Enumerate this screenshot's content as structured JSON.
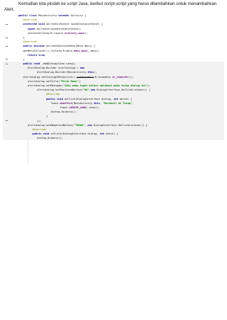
{
  "intro": {
    "text": "Kemudian kita pindah ke script Java, berikut script-script yang harus ditambahkan untuk menambahkan Alert."
  },
  "code": {
    "lines": [
      {
        "indent": 0,
        "fold": false,
        "band": false,
        "segments": [
          {
            "s": "kw",
            "t": "public class "
          },
          {
            "s": "plain",
            "t": "MainActivity "
          },
          {
            "s": "kw",
            "t": "extends "
          },
          {
            "s": "plain",
            "t": "Activity {"
          }
        ]
      },
      {
        "indent": 1,
        "fold": false,
        "band": false,
        "segments": [
          {
            "s": "ann",
            "t": "@Override"
          }
        ]
      },
      {
        "indent": 1,
        "fold": true,
        "band": false,
        "segments": [
          {
            "s": "kw",
            "t": "protected void "
          },
          {
            "s": "plain",
            "t": "onCreate(Bundle savedInstanceState) {"
          }
        ]
      },
      {
        "indent": 2,
        "fold": false,
        "band": false,
        "segments": [
          {
            "s": "kw",
            "t": "super"
          },
          {
            "s": "plain",
            "t": ".onCreate(savedInstanceState);"
          }
        ]
      },
      {
        "indent": 2,
        "fold": false,
        "band": false,
        "segments": [
          {
            "s": "plain",
            "t": "setContentView(R.layout."
          },
          {
            "s": "fld",
            "t": "activity_main"
          },
          {
            "s": "plain",
            "t": ");"
          }
        ]
      },
      {
        "indent": 1,
        "fold": true,
        "band": false,
        "segments": [
          {
            "s": "plain",
            "t": "}"
          }
        ]
      },
      {
        "indent": 1,
        "fold": false,
        "band": false,
        "segments": [
          {
            "s": "ann",
            "t": "@Override"
          }
        ]
      },
      {
        "indent": 1,
        "fold": true,
        "band": false,
        "segments": [
          {
            "s": "kw",
            "t": "public boolean "
          },
          {
            "s": "plain",
            "t": "onCreateOptionsMenu(Menu menu) {"
          }
        ]
      },
      {
        "indent": 1,
        "fold": false,
        "band": false,
        "segments": [
          {
            "s": "plain",
            "t": "getMenuInflater().inflate(R.menu."
          },
          {
            "s": "fld",
            "t": "menu_main"
          },
          {
            "s": "plain",
            "t": ", menu);"
          }
        ]
      },
      {
        "indent": 2,
        "fold": false,
        "band": false,
        "segments": [
          {
            "s": "kw",
            "t": "return true"
          },
          {
            "s": "plain",
            "t": ";"
          }
        ]
      },
      {
        "indent": 1,
        "fold": true,
        "band": false,
        "segments": [
          {
            "s": "plain",
            "t": "}"
          }
        ]
      },
      {
        "indent": 1,
        "fold": true,
        "band": true,
        "segments": [
          {
            "s": "kw",
            "t": "public void "
          },
          {
            "s": "plain",
            "t": "_addDialog(View view){"
          }
        ]
      },
      {
        "indent": 2,
        "fold": false,
        "band": true,
        "segments": [
          {
            "s": "plain",
            "t": "AlertDialog.Builder alertdialog = "
          },
          {
            "s": "kw",
            "t": "new"
          }
        ]
      },
      {
        "indent": 4,
        "fold": false,
        "band": true,
        "segments": [
          {
            "s": "plain",
            "t": "AlertDialog.Builder(MainActivity."
          },
          {
            "s": "kw",
            "t": "this"
          },
          {
            "s": "plain",
            "t": ");"
          }
        ]
      },
      {
        "indent": 1,
        "fold": false,
        "band": true,
        "segments": [
          {
            "s": "plain",
            "t": "alertdialog.setIcon(getResources()."
          },
          {
            "s": "strike",
            "t": "getDrawable"
          },
          {
            "s": "plain",
            "t": "(R.drawable."
          },
          {
            "s": "fld",
            "t": "ic_launcher"
          },
          {
            "s": "plain",
            "t": "));"
          }
        ]
      },
      {
        "indent": 2,
        "fold": false,
        "band": true,
        "segments": [
          {
            "s": "plain",
            "t": "alertdialog.setTitle("
          },
          {
            "s": "str",
            "t": "\"Pilih Menu\""
          },
          {
            "s": "plain",
            "t": ");"
          }
        ]
      },
      {
        "indent": 2,
        "fold": false,
        "band": true,
        "segments": [
          {
            "s": "plain",
            "t": "alertdialog.setMessage("
          },
          {
            "s": "str",
            "t": "\"Jika anda ingin keluar aplikasi maka tutup dialog ini\""
          },
          {
            "s": "plain",
            "t": ");"
          }
        ]
      },
      {
        "indent": 4,
        "fold": false,
        "band": true,
        "segments": [
          {
            "s": "plain",
            "t": "alertdialog.setPositiveButton("
          },
          {
            "s": "str",
            "t": "\"OK\""
          },
          {
            "s": "plain",
            "t": ","
          },
          {
            "s": "kw",
            "t": "new "
          },
          {
            "s": "plain",
            "t": "DialogInterface.OnClickListener() {"
          }
        ]
      },
      {
        "indent": 6,
        "fold": false,
        "band": true,
        "segments": [
          {
            "s": "ann",
            "t": "@Override"
          }
        ]
      },
      {
        "indent": 6,
        "fold": false,
        "band": true,
        "segments": [
          {
            "s": "kw",
            "t": "public void "
          },
          {
            "s": "plain",
            "t": "onClick(DialogInterface dialog, "
          },
          {
            "s": "kw",
            "t": "int "
          },
          {
            "s": "plain",
            "t": "which) {"
          }
        ]
      },
      {
        "indent": 7,
        "fold": false,
        "band": true,
        "segments": [
          {
            "s": "plain",
            "t": "Toast."
          },
          {
            "s": "fld",
            "t": "makeText"
          },
          {
            "s": "plain",
            "t": "(MainActivity."
          },
          {
            "s": "kw",
            "t": "this"
          },
          {
            "s": "plain",
            "t": ", "
          },
          {
            "s": "str",
            "t": "\"Berhasil di Tutup\""
          },
          {
            "s": "plain",
            "t": ","
          }
        ]
      },
      {
        "indent": 9,
        "fold": false,
        "band": true,
        "segments": [
          {
            "s": "plain",
            "t": "Toast."
          },
          {
            "s": "fld",
            "t": "LENGTH_LONG"
          },
          {
            "s": "plain",
            "t": ").show();"
          }
        ]
      },
      {
        "indent": 7,
        "fold": false,
        "band": true,
        "segments": [
          {
            "s": "plain",
            "t": "dialog.dismiss();"
          }
        ]
      },
      {
        "indent": 6,
        "fold": false,
        "band": true,
        "segments": [
          {
            "s": "plain",
            "t": "}"
          }
        ]
      },
      {
        "indent": 4,
        "fold": true,
        "band": true,
        "segments": [
          {
            "s": "plain",
            "t": "});"
          }
        ]
      },
      {
        "indent": 2,
        "fold": false,
        "band": true,
        "segments": [
          {
            "s": "plain",
            "t": "alertdialog.setNegativeButton("
          },
          {
            "s": "str",
            "t": "\"TIDAK\""
          },
          {
            "s": "plain",
            "t": ", "
          },
          {
            "s": "kw",
            "t": "new "
          },
          {
            "s": "plain",
            "t": "DialogInterface.OnClickListener() {"
          }
        ]
      },
      {
        "indent": 3,
        "fold": false,
        "band": true,
        "segments": [
          {
            "s": "ann",
            "t": "@Override"
          }
        ]
      },
      {
        "indent": 3,
        "fold": false,
        "band": true,
        "segments": [
          {
            "s": "kw",
            "t": "public void "
          },
          {
            "s": "plain",
            "t": "onClick(DialogInterface dialog, "
          },
          {
            "s": "kw",
            "t": "int "
          },
          {
            "s": "plain",
            "t": "which) {"
          }
        ]
      },
      {
        "indent": 4,
        "fold": false,
        "band": true,
        "segments": [
          {
            "s": "plain",
            "t": "dialog.dismiss();"
          }
        ]
      }
    ]
  }
}
